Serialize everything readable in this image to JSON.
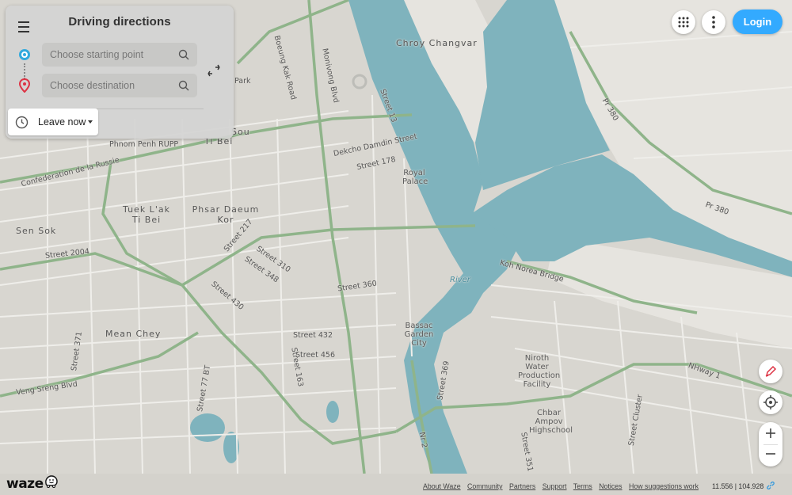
{
  "panel": {
    "title": "Driving directions",
    "start_placeholder": "Choose starting point",
    "destination_placeholder": "Choose destination",
    "leave_label": "Leave now"
  },
  "header": {
    "login_label": "Login"
  },
  "map": {
    "places": [
      "Chroy Changvar",
      "Royal Palace",
      "Tuek L'ak Ti Bei",
      "Phsar Daeum Kor",
      "Sen Sok",
      "Mean Chey",
      "Bassac Garden City",
      "Niroth Water Production Facility",
      "Chbar Ampov Highschool",
      "River"
    ],
    "roads": [
      "Boeung Kak Road",
      "Monivong Blvd",
      "Street 13",
      "Dekcho Damdin Street",
      "Street 178",
      "Confederation de la Russie",
      "Street 2004",
      "Street 217",
      "Street 310",
      "Street 348",
      "Street 430",
      "Street 360",
      "Street 432",
      "Street 456",
      "Street 163",
      "Street 371",
      "Veng Sreng Blvd",
      "Street 77 BT",
      "Koh Norea Bridge",
      "NHway 1",
      "Street 369",
      "Street 351",
      "Street Cluster",
      "Nr 2",
      "Pr 380",
      "Pr 380",
      "Park",
      "Phnom Penh RUPP",
      "Ti Bei",
      "Sou"
    ]
  },
  "footer": {
    "links": [
      "About Waze",
      "Community",
      "Partners",
      "Support",
      "Terms",
      "Notices",
      "How suggestions work"
    ],
    "coordinates": "11.556 | 104.928",
    "logo_text": "waze"
  },
  "colors": {
    "water": "#7fb3bd",
    "land": "#d8d6d0",
    "sandbar": "#e6e4df",
    "road_major": "#8fb48a",
    "road_minor": "#f0efec",
    "accent": "#33aaff"
  }
}
